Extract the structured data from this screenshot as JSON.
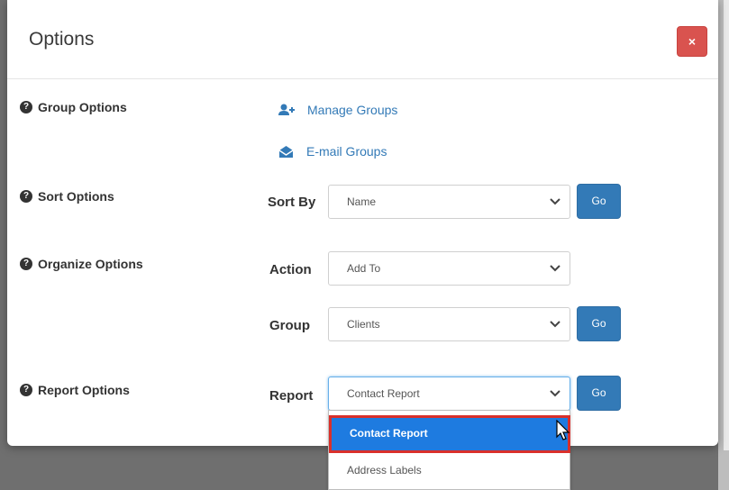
{
  "modal": {
    "title": "Options",
    "close_label": "×"
  },
  "group_options": {
    "label": "Group Options",
    "manage_groups": "Manage Groups",
    "email_groups": "E-mail Groups"
  },
  "sort_options": {
    "label": "Sort Options",
    "field_label": "Sort By",
    "selected": "Name",
    "go_label": "Go"
  },
  "organize_options": {
    "label": "Organize Options",
    "action_label": "Action",
    "action_selected": "Add To",
    "group_label": "Group",
    "group_selected": "Clients",
    "go_label": "Go"
  },
  "report_options": {
    "label": "Report Options",
    "field_label": "Report",
    "selected": "Contact Report",
    "go_label": "Go",
    "dropdown_options": [
      "Contact Report",
      "Address Labels"
    ]
  },
  "colors": {
    "primary": "#337ab7",
    "danger": "#d9534f",
    "highlight": "#1e7be0",
    "highlight_border": "#d9302b"
  },
  "icons": {
    "help": "question-circle-icon",
    "manage_groups": "user-plus-icon",
    "email_groups": "envelope-open-icon",
    "chevron": "chevron-down-icon",
    "pointer": "mouse-pointer-icon"
  }
}
